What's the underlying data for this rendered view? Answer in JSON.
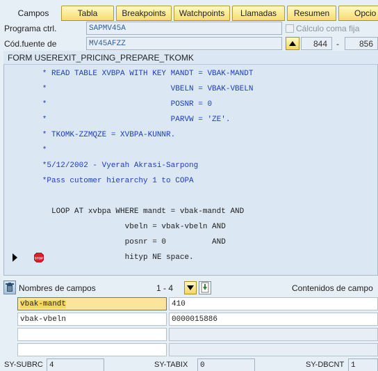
{
  "tabs": {
    "active": "Campos",
    "items": [
      "Tabla",
      "Breakpoints",
      "Watchpoints",
      "Llamadas",
      "Resumen",
      "Opcio"
    ]
  },
  "program": {
    "label": "Programa ctrl.",
    "value": "SAPMV45A",
    "checkbox_label": "Cálculo coma fija"
  },
  "source": {
    "label": "Cód.fuente de",
    "value": "MV45AFZZ",
    "line_from": "844",
    "separator": "-",
    "line_to": "856"
  },
  "code": {
    "header": "FORM USEREXIT_PRICING_PREPARE_TKOMK",
    "lines": [
      {
        "text": "        * READ TABLE XVBPA WITH KEY MANDT = VBAK-MANDT",
        "type": "comment"
      },
      {
        "text": "        *                           VBELN = VBAK-VBELN",
        "type": "comment"
      },
      {
        "text": "        *                           POSNR = 0",
        "type": "comment"
      },
      {
        "text": "        *                           PARVW = 'ZE'.",
        "type": "comment"
      },
      {
        "text": "        * TKOMK-ZZMQZE = XVBPA-KUNNR.",
        "type": "comment"
      },
      {
        "text": "        *",
        "type": "comment"
      },
      {
        "text": "        *5/12/2002 - Vyerah Akrasi-Sarpong",
        "type": "comment"
      },
      {
        "text": "        *Pass cutomer hierarchy 1 to COPA",
        "type": "comment"
      },
      {
        "text": "",
        "type": "source"
      },
      {
        "text": "          LOOP AT xvbpa WHERE mandt = vbak-mandt AND",
        "type": "source"
      },
      {
        "text": "                          vbeln = vbak-vbeln AND",
        "type": "source"
      },
      {
        "text": "                          posnr = 0          AND",
        "type": "source"
      },
      {
        "text": "                          hityp NE space.",
        "type": "source"
      }
    ]
  },
  "fields": {
    "names_label": "Nombres de campos",
    "range": "1  -  4",
    "contents_label": "Contenidos de campo",
    "rows": [
      {
        "name": "vbak-mandt",
        "value": "410"
      },
      {
        "name": "vbak-vbeln",
        "value": "0000015886"
      },
      {
        "name": "",
        "value": ""
      },
      {
        "name": "",
        "value": ""
      }
    ]
  },
  "status": {
    "subrc_label": "SY-SUBRC",
    "subrc_value": "4",
    "tabix_label": "SY-TABIX",
    "tabix_value": "0",
    "dbcnt_label": "SY-DBCNT",
    "dbcnt_value": "1"
  },
  "colors": {
    "background": "#e6eef6",
    "tab_yellow": "#f6dd6e",
    "comment_blue": "#1d3cc4",
    "stop_red": "#d8202a"
  }
}
